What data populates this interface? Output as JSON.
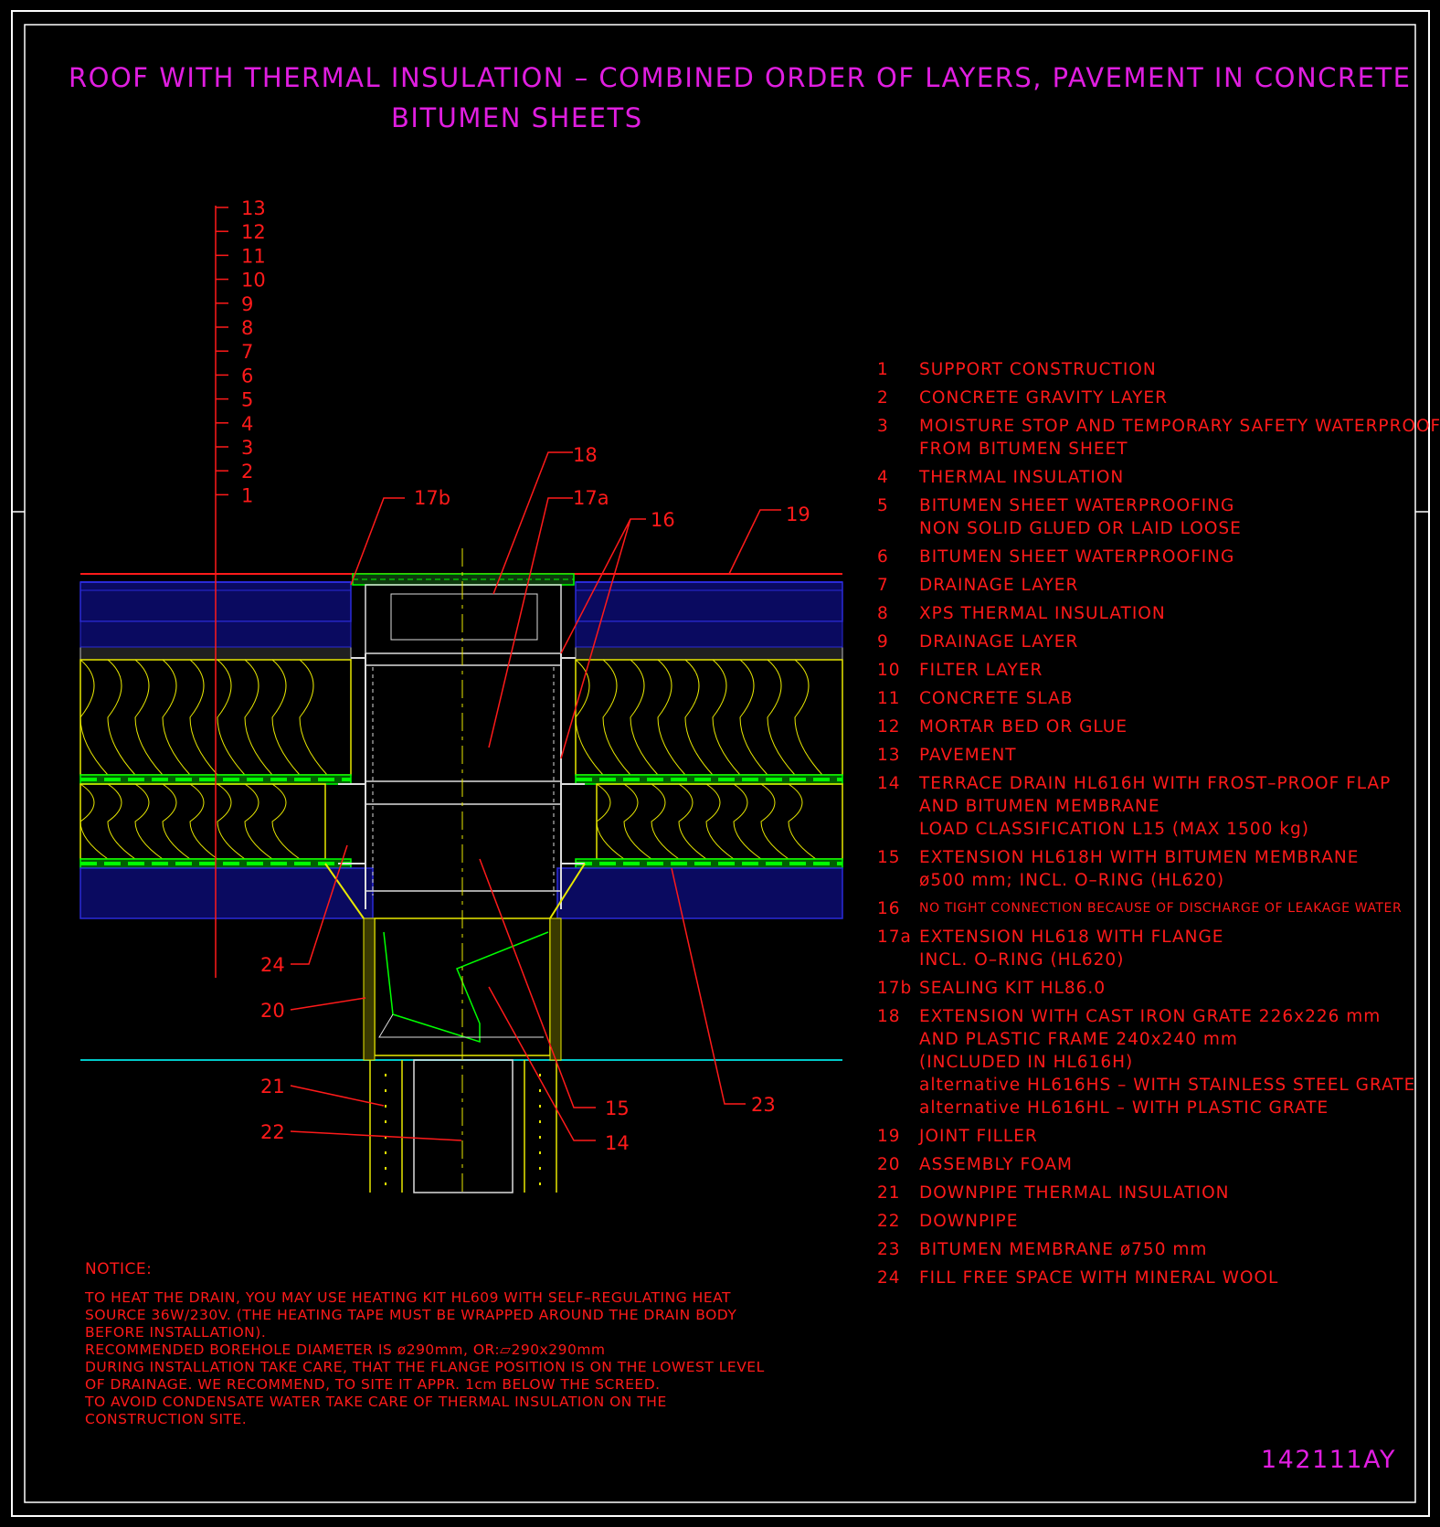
{
  "title": {
    "line1": "ROOF WITH THERMAL INSULATION – COMBINED ORDER OF LAYERS, PAVEMENT IN CONCRETE",
    "line2": "BITUMEN SHEETS"
  },
  "layer_scale_labels": [
    "13",
    "12",
    "11",
    "10",
    "9",
    "8",
    "7",
    "6",
    "5",
    "4",
    "3",
    "2",
    "1"
  ],
  "callouts": {
    "c18": "18",
    "c17b": "17b",
    "c17a": "17a",
    "c16": "16",
    "c19": "19",
    "c24": "24",
    "c20": "20",
    "c21": "21",
    "c22": "22",
    "c15": "15",
    "c14": "14",
    "c23": "23"
  },
  "legend": [
    {
      "num": "1",
      "lines": [
        "SUPPORT CONSTRUCTION"
      ]
    },
    {
      "num": "2",
      "lines": [
        "CONCRETE GRAVITY LAYER"
      ]
    },
    {
      "num": "3",
      "lines": [
        "MOISTURE STOP AND TEMPORARY SAFETY WATERPROOFING",
        "FROM BITUMEN SHEET"
      ]
    },
    {
      "num": "4",
      "lines": [
        "THERMAL INSULATION"
      ]
    },
    {
      "num": "5",
      "lines": [
        "BITUMEN SHEET WATERPROOFING",
        "NON SOLID GLUED OR LAID LOOSE"
      ]
    },
    {
      "num": "6",
      "lines": [
        "BITUMEN SHEET WATERPROOFING"
      ]
    },
    {
      "num": "7",
      "lines": [
        "DRAINAGE LAYER"
      ]
    },
    {
      "num": "8",
      "lines": [
        "XPS THERMAL INSULATION"
      ]
    },
    {
      "num": "9",
      "lines": [
        "DRAINAGE LAYER"
      ]
    },
    {
      "num": "10",
      "lines": [
        "FILTER LAYER"
      ]
    },
    {
      "num": "11",
      "lines": [
        "CONCRETE SLAB"
      ]
    },
    {
      "num": "12",
      "lines": [
        "MORTAR BED OR GLUE"
      ]
    },
    {
      "num": "13",
      "lines": [
        "PAVEMENT"
      ]
    },
    {
      "num": "14",
      "lines": [
        "TERRACE DRAIN HL616H WITH FROST–PROOF FLAP",
        "AND BITUMEN MEMBRANE",
        "LOAD CLASSIFICATION L15 (MAX 1500 kg)"
      ]
    },
    {
      "num": "15",
      "lines": [
        "EXTENSION HL618H WITH BITUMEN MEMBRANE",
        "ø500 mm; INCL. O–RING (HL620)"
      ]
    },
    {
      "num": "16",
      "lines": [
        "NO TIGHT CONNECTION BECAUSE OF DISCHARGE OF LEAKAGE WATER"
      ],
      "small": true
    },
    {
      "num": "17a",
      "lines": [
        "EXTENSION HL618 WITH FLANGE",
        "INCL. O–RING (HL620)"
      ]
    },
    {
      "num": "17b",
      "lines": [
        "SEALING KIT HL86.0"
      ]
    },
    {
      "num": "18",
      "lines": [
        "EXTENSION WITH CAST IRON GRATE 226x226 mm",
        "AND PLASTIC FRAME 240x240 mm",
        "(INCLUDED IN HL616H)",
        "alternative HL616HS – WITH STAINLESS STEEL GRATE",
        "alternative HL616HL – WITH PLASTIC GRATE"
      ]
    },
    {
      "num": "19",
      "lines": [
        "JOINT FILLER"
      ]
    },
    {
      "num": "20",
      "lines": [
        "ASSEMBLY FOAM"
      ]
    },
    {
      "num": "21",
      "lines": [
        "DOWNPIPE THERMAL INSULATION"
      ]
    },
    {
      "num": "22",
      "lines": [
        "DOWNPIPE"
      ]
    },
    {
      "num": "23",
      "lines": [
        "BITUMEN MEMBRANE ø750 mm"
      ]
    },
    {
      "num": "24",
      "lines": [
        "FILL FREE SPACE WITH MINERAL WOOL"
      ]
    }
  ],
  "notice": {
    "heading": "NOTICE:",
    "lines": [
      "TO HEAT THE DRAIN, YOU MAY USE HEATING KIT HL609 WITH SELF–REGULATING HEAT",
      "SOURCE 36W/230V. (THE HEATING TAPE MUST BE WRAPPED AROUND THE DRAIN BODY",
      "BEFORE INSTALLATION).",
      "RECOMMENDED BOREHOLE DIAMETER IS ø290mm, OR:▱290x290mm",
      "DURING INSTALLATION TAKE CARE, THAT THE FLANGE POSITION IS ON THE LOWEST LEVEL",
      "OF DRAINAGE. WE RECOMMEND, TO SITE IT APPR. 1cm BELOW THE SCREED.",
      "TO AVOID CONDENSATE WATER TAKE CARE OF THERMAL INSULATION ON THE",
      "CONSTRUCTION SITE."
    ]
  },
  "drawing_code": "142111AY",
  "colors": {
    "background": "#000000",
    "title": "#e01ee0",
    "text_red": "#ff1a1a",
    "insulation_yellow": "#e8e800",
    "drainage_green": "#00ff00",
    "concrete_blue": "#2a2ad8",
    "base_line_cyan": "#00c8c8",
    "frame_white": "#ffffff"
  }
}
